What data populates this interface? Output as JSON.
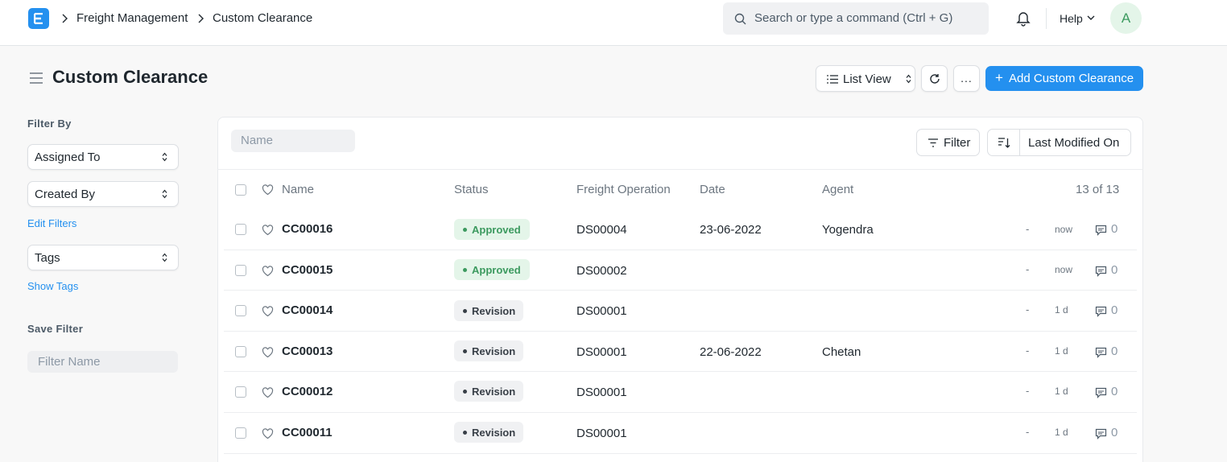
{
  "navbar": {
    "breadcrumbs": [
      "Freight Management",
      "Custom Clearance"
    ],
    "search_placeholder": "Search or type a command (Ctrl + G)",
    "help_label": "Help",
    "avatar_initial": "A"
  },
  "page": {
    "title": "Custom Clearance",
    "view_label": "List View",
    "more_label": "...",
    "add_label": "Add Custom Clearance",
    "add_plus": "+"
  },
  "sidebar": {
    "filter_by_heading": "Filter By",
    "assigned_to": "Assigned To",
    "created_by": "Created By",
    "edit_filters": "Edit Filters",
    "tags": "Tags",
    "show_tags": "Show Tags",
    "save_filter_heading": "Save Filter",
    "filter_name_placeholder": "Filter Name"
  },
  "list": {
    "name_filter_placeholder": "Name",
    "filter_label": "Filter",
    "sort_label": "Last Modified On",
    "columns": {
      "name": "Name",
      "status": "Status",
      "freight_operation": "Freight Operation",
      "date": "Date",
      "agent": "Agent"
    },
    "count": "13 of 13",
    "rows": [
      {
        "name": "CC00016",
        "status": "Approved",
        "freight_operation": "DS00004",
        "date": "23-06-2022",
        "agent": "Yogendra",
        "dash": "-",
        "modified": "now",
        "comments": "0"
      },
      {
        "name": "CC00015",
        "status": "Approved",
        "freight_operation": "DS00002",
        "date": "",
        "agent": "",
        "dash": "-",
        "modified": "now",
        "comments": "0"
      },
      {
        "name": "CC00014",
        "status": "Revision",
        "freight_operation": "DS00001",
        "date": "",
        "agent": "",
        "dash": "-",
        "modified": "1 d",
        "comments": "0"
      },
      {
        "name": "CC00013",
        "status": "Revision",
        "freight_operation": "DS00001",
        "date": "22-06-2022",
        "agent": "Chetan",
        "dash": "-",
        "modified": "1 d",
        "comments": "0"
      },
      {
        "name": "CC00012",
        "status": "Revision",
        "freight_operation": "DS00001",
        "date": "",
        "agent": "",
        "dash": "-",
        "modified": "1 d",
        "comments": "0"
      },
      {
        "name": "CC00011",
        "status": "Revision",
        "freight_operation": "DS00001",
        "date": "",
        "agent": "",
        "dash": "-",
        "modified": "1 d",
        "comments": "0"
      }
    ]
  },
  "colors": {
    "primary": "#2490ef",
    "approved_bg": "#e4f5e9",
    "approved_text": "#3c9a5f",
    "revision_bg": "#f0f1f3",
    "revision_text": "#383f47"
  },
  "icons": {
    "logo": "app-logo-icon",
    "search": "search-icon",
    "notifications": "bell-icon",
    "list_view": "list-icon",
    "refresh": "refresh-icon",
    "filter": "filter-icon",
    "sort": "sort-descending-icon",
    "like": "heart-icon",
    "comments": "comment-icon"
  }
}
